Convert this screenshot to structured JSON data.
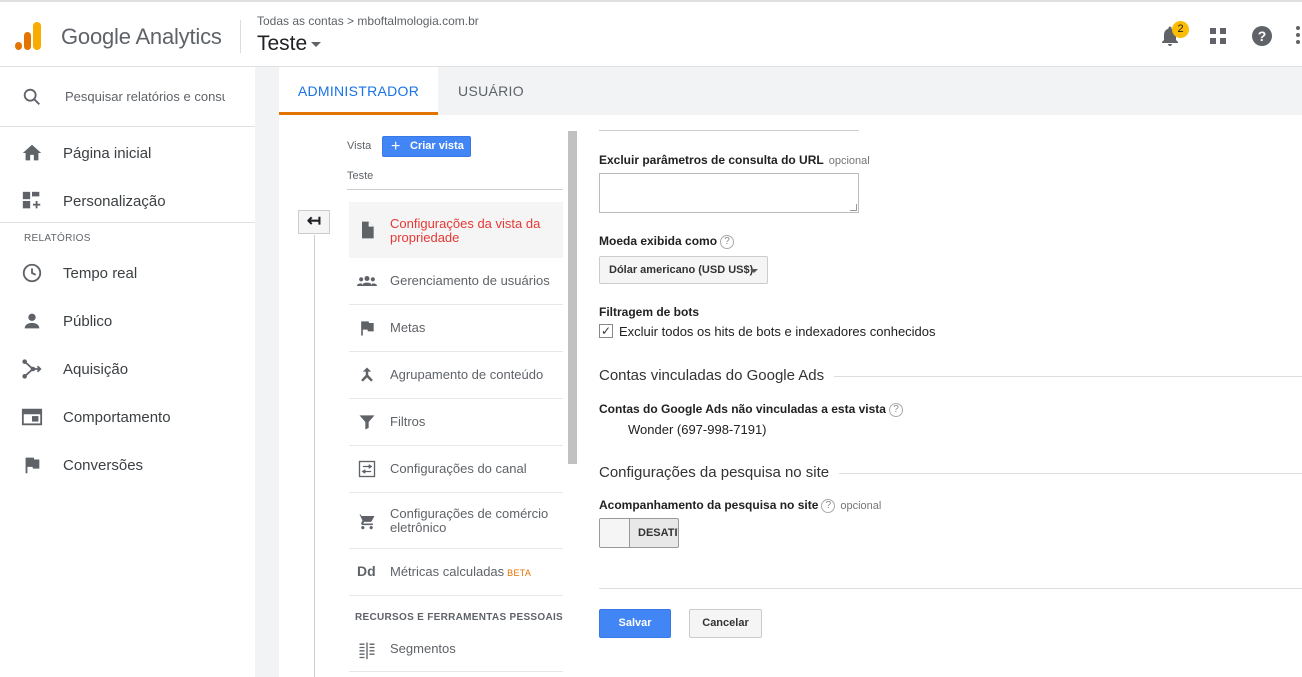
{
  "header": {
    "app_name": "Google Analytics",
    "breadcrumb": "Todas as contas > mboftalmologia.com.br",
    "view_name": "Teste",
    "notifications_count": "2"
  },
  "sidebar": {
    "search_placeholder": "Pesquisar relatórios e consultas",
    "items": [
      {
        "label": "Página inicial",
        "icon": "home-icon"
      },
      {
        "label": "Personalização",
        "icon": "dashboard-add-icon"
      }
    ],
    "section_label": "RELATÓRIOS",
    "report_items": [
      {
        "label": "Tempo real",
        "icon": "clock-icon"
      },
      {
        "label": "Público",
        "icon": "person-icon"
      },
      {
        "label": "Aquisição",
        "icon": "acquisition-icon"
      },
      {
        "label": "Comportamento",
        "icon": "behavior-icon"
      },
      {
        "label": "Conversões",
        "icon": "flag-icon"
      }
    ]
  },
  "tabs": {
    "admin": "ADMINISTRADOR",
    "user": "USUÁRIO"
  },
  "view_column": {
    "vista_label": "Vista",
    "create_view_label": "Criar vista",
    "current_view": "Teste",
    "menu": [
      {
        "label": "Configurações da vista da propriedade",
        "icon": "document-icon",
        "active": true
      },
      {
        "label": "Gerenciamento de usuários",
        "icon": "users-icon"
      },
      {
        "label": "Metas",
        "icon": "flag-icon"
      },
      {
        "label": "Agrupamento de conteúdo",
        "icon": "merge-icon"
      },
      {
        "label": "Filtros",
        "icon": "filter-icon"
      },
      {
        "label": "Configurações do canal",
        "icon": "channel-settings-icon"
      },
      {
        "label": "Configurações de comércio eletrônico",
        "icon": "cart-icon"
      },
      {
        "label": "Métricas calculadas",
        "icon": "dd-icon",
        "badge": "BETA"
      }
    ],
    "resources_label": "RECURSOS E FERRAMENTAS PESSOAIS",
    "resources": [
      {
        "label": "Segmentos",
        "icon": "segments-icon"
      }
    ]
  },
  "form": {
    "exclude_params_label": "Excluir parâmetros de consulta do URL",
    "optional": "opcional",
    "exclude_params_value": "",
    "currency_label": "Moeda exibida como",
    "currency_value": "Dólar americano (USD US$)",
    "bot_filter_label": "Filtragem de bots",
    "bot_filter_checkbox": "Excluir todos os hits de bots e indexadores conhecidos",
    "bot_filter_checked": true,
    "ads_section": "Contas vinculadas do Google Ads",
    "ads_unlinked_label": "Contas do Google Ads não vinculadas a esta vista",
    "ads_account": "Wonder (697-998-7191)",
    "search_section": "Configurações da pesquisa no site",
    "site_search_label": "Acompanhamento da pesquisa no site",
    "site_search_toggle": "DESATIVADO",
    "save": "Salvar",
    "cancel": "Cancelar"
  }
}
